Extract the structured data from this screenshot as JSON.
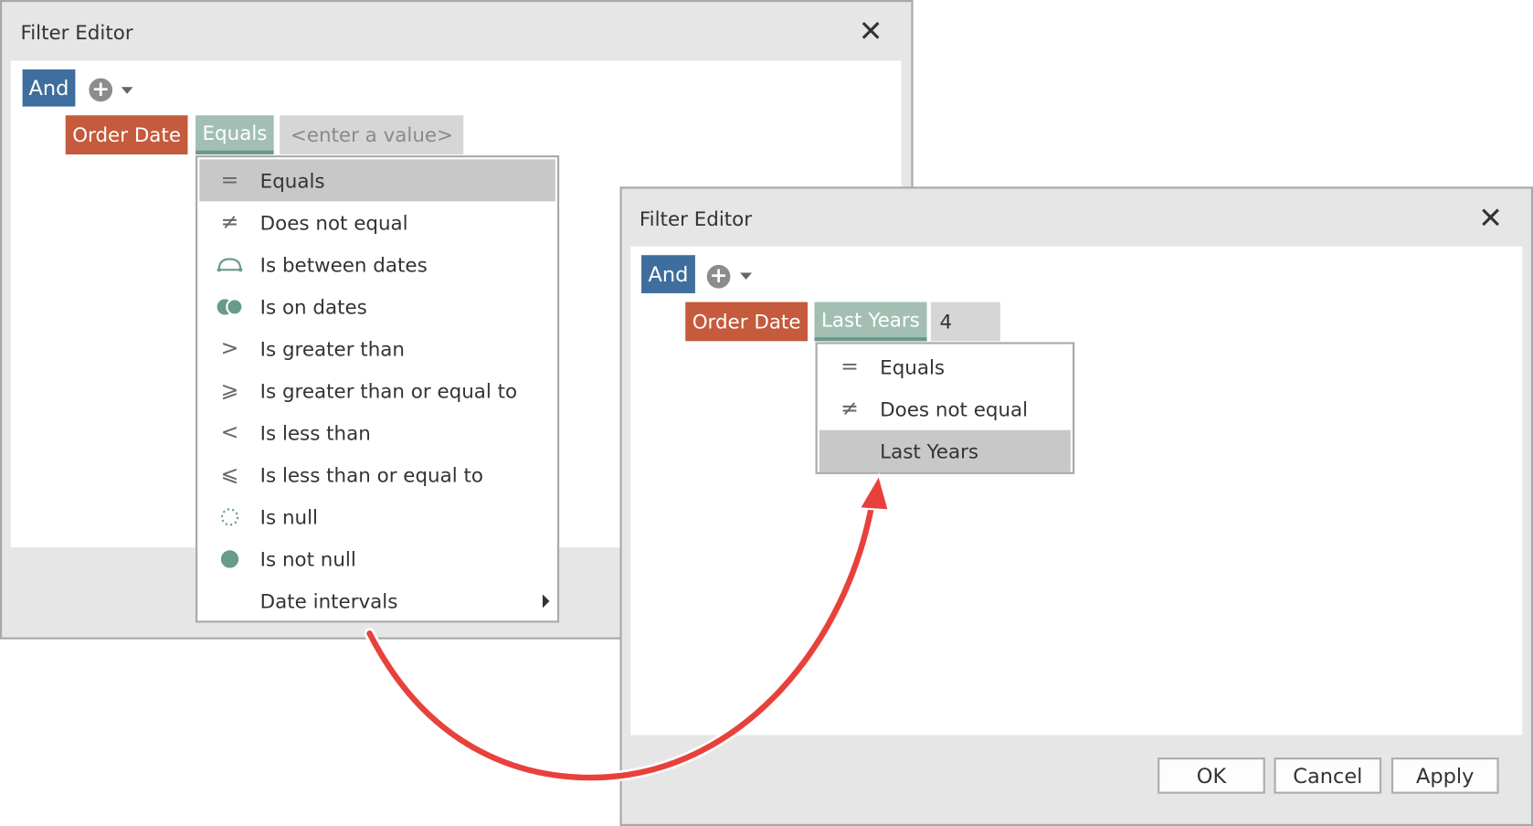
{
  "left_dialog": {
    "title": "Filter Editor",
    "group_operator": "And",
    "condition": {
      "field": "Order Date",
      "operator": "Equals",
      "value_placeholder": "<enter a value>"
    },
    "menu": [
      {
        "icon": "equals-icon",
        "label": "Equals",
        "selected": true
      },
      {
        "icon": "not-equal-icon",
        "label": "Does not equal"
      },
      {
        "icon": "between-icon",
        "label": "Is between dates"
      },
      {
        "icon": "on-dates-icon",
        "label": "Is on dates"
      },
      {
        "icon": "greater-than-icon",
        "label": "Is greater than"
      },
      {
        "icon": "greater-equal-icon",
        "label": "Is greater than or equal to"
      },
      {
        "icon": "less-than-icon",
        "label": "Is less than"
      },
      {
        "icon": "less-equal-icon",
        "label": "Is less than or equal to"
      },
      {
        "icon": "null-icon",
        "label": "Is null"
      },
      {
        "icon": "not-null-icon",
        "label": "Is not null"
      },
      {
        "icon": "",
        "label": "Date intervals",
        "submenu": true
      }
    ]
  },
  "right_dialog": {
    "title": "Filter Editor",
    "group_operator": "And",
    "condition": {
      "field": "Order Date",
      "operator": "Last Years",
      "value": "4"
    },
    "menu": [
      {
        "icon": "equals-icon",
        "label": "Equals"
      },
      {
        "icon": "not-equal-icon",
        "label": "Does not equal"
      },
      {
        "icon": "",
        "label": "Last Years",
        "selected": true
      }
    ],
    "buttons": {
      "ok": "OK",
      "cancel": "Cancel",
      "apply": "Apply"
    }
  },
  "colors": {
    "group": "#3f6e9e",
    "field": "#c55a3c",
    "operator": "#a3bfb3",
    "arrow": "#e8413c"
  }
}
